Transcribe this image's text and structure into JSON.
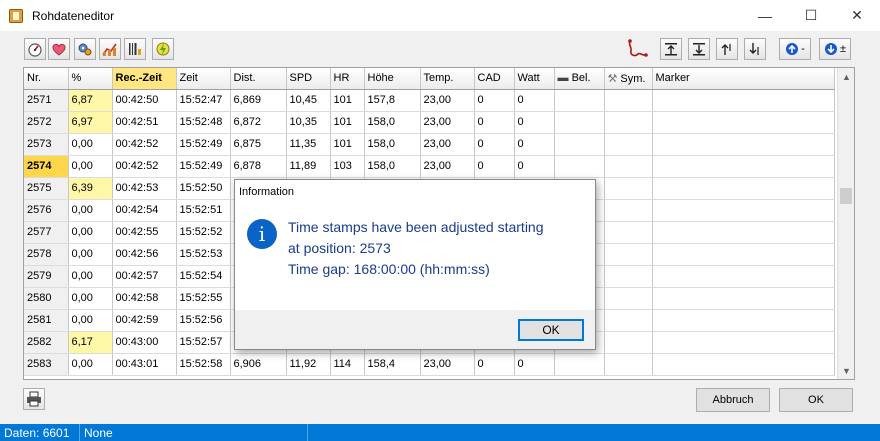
{
  "window": {
    "title": "Rohdateneditor",
    "minimize": "—",
    "maximize": "☐",
    "close": "✕"
  },
  "toolbar": {
    "left_icons": [
      "gauge-icon",
      "heart-icon",
      "gears-icon",
      "chart-icon",
      "barcode-icon",
      "lightning-icon"
    ],
    "right_icons": [
      "route-icon",
      "insert-top-icon",
      "insert-bottom-icon",
      "move-up-icon",
      "move-down-icon"
    ],
    "up_minus_label": "-",
    "down_plus_label": "±"
  },
  "grid": {
    "columns": [
      "Nr.",
      "%",
      "Rec.-Zeit",
      "Zeit",
      "Dist.",
      "SPD",
      "HR",
      "Höhe",
      "Temp.",
      "CAD",
      "Watt",
      "Bel.",
      "Sym.",
      "Marker"
    ],
    "highlighted_column": "Rec.-Zeit",
    "selected_row": "2574",
    "rows": [
      {
        "nr": "2571",
        "pct": "6,87",
        "rec": "00:42:50",
        "zeit": "15:52:47",
        "dist": "6,869",
        "spd": "10,45",
        "hr": "101",
        "hoehe": "157,8",
        "temp": "23,00",
        "cad": "0",
        "watt": "0",
        "pct_yellow": true
      },
      {
        "nr": "2572",
        "pct": "6,97",
        "rec": "00:42:51",
        "zeit": "15:52:48",
        "dist": "6,872",
        "spd": "10,35",
        "hr": "101",
        "hoehe": "158,0",
        "temp": "23,00",
        "cad": "0",
        "watt": "0",
        "pct_yellow": true
      },
      {
        "nr": "2573",
        "pct": "0,00",
        "rec": "00:42:52",
        "zeit": "15:52:49",
        "dist": "6,875",
        "spd": "11,35",
        "hr": "101",
        "hoehe": "158,0",
        "temp": "23,00",
        "cad": "0",
        "watt": "0",
        "pct_yellow": false
      },
      {
        "nr": "2574",
        "pct": "0,00",
        "rec": "00:42:52",
        "zeit": "15:52:49",
        "dist": "6,878",
        "spd": "11,89",
        "hr": "103",
        "hoehe": "158,0",
        "temp": "23,00",
        "cad": "0",
        "watt": "0",
        "pct_yellow": false
      },
      {
        "nr": "2575",
        "pct": "6,39",
        "rec": "00:42:53",
        "zeit": "15:52:50",
        "dist": "",
        "spd": "",
        "hr": "",
        "hoehe": "",
        "temp": "",
        "cad": "",
        "watt": "",
        "pct_yellow": true
      },
      {
        "nr": "2576",
        "pct": "0,00",
        "rec": "00:42:54",
        "zeit": "15:52:51",
        "dist": "",
        "spd": "",
        "hr": "",
        "hoehe": "",
        "temp": "",
        "cad": "",
        "watt": "",
        "pct_yellow": false
      },
      {
        "nr": "2577",
        "pct": "0,00",
        "rec": "00:42:55",
        "zeit": "15:52:52",
        "dist": "",
        "spd": "",
        "hr": "",
        "hoehe": "",
        "temp": "",
        "cad": "",
        "watt": "",
        "pct_yellow": false
      },
      {
        "nr": "2578",
        "pct": "0,00",
        "rec": "00:42:56",
        "zeit": "15:52:53",
        "dist": "",
        "spd": "",
        "hr": "",
        "hoehe": "",
        "temp": "",
        "cad": "",
        "watt": "",
        "pct_yellow": false
      },
      {
        "nr": "2579",
        "pct": "0,00",
        "rec": "00:42:57",
        "zeit": "15:52:54",
        "dist": "",
        "spd": "",
        "hr": "",
        "hoehe": "",
        "temp": "",
        "cad": "",
        "watt": "",
        "pct_yellow": false
      },
      {
        "nr": "2580",
        "pct": "0,00",
        "rec": "00:42:58",
        "zeit": "15:52:55",
        "dist": "",
        "spd": "",
        "hr": "",
        "hoehe": "",
        "temp": "",
        "cad": "",
        "watt": "",
        "pct_yellow": false
      },
      {
        "nr": "2581",
        "pct": "0,00",
        "rec": "00:42:59",
        "zeit": "15:52:56",
        "dist": "",
        "spd": "",
        "hr": "",
        "hoehe": "",
        "temp": "",
        "cad": "",
        "watt": "",
        "pct_yellow": false
      },
      {
        "nr": "2582",
        "pct": "6,17",
        "rec": "00:43:00",
        "zeit": "15:52:57",
        "dist": "",
        "spd": "",
        "hr": "",
        "hoehe": "",
        "temp": "",
        "cad": "",
        "watt": "",
        "pct_yellow": true
      },
      {
        "nr": "2583",
        "pct": "0,00",
        "rec": "00:43:01",
        "zeit": "15:52:58",
        "dist": "6,906",
        "spd": "11,92",
        "hr": "114",
        "hoehe": "158,4",
        "temp": "23,00",
        "cad": "0",
        "watt": "0",
        "pct_yellow": false
      }
    ]
  },
  "dialog": {
    "title": "Information",
    "message_line1": "Time stamps have been adjusted starting",
    "message_line2": "at position: 2573",
    "message_line3": "Time gap: 168:00:00 (hh:mm:ss)",
    "ok_label": "OK",
    "icon": "info-icon"
  },
  "buttons": {
    "abbruch": "Abbruch",
    "ok": "OK"
  },
  "status": {
    "daten": "Daten: 6601",
    "mode": "None"
  },
  "colors": {
    "status_bar": "#0078d7",
    "highlight_header": "#ffe680",
    "selected_row_number": "#ffd54a",
    "percent_yellow": "#fff7a8",
    "dialog_text": "#1a3c8c",
    "info_icon": "#0a64c8"
  }
}
